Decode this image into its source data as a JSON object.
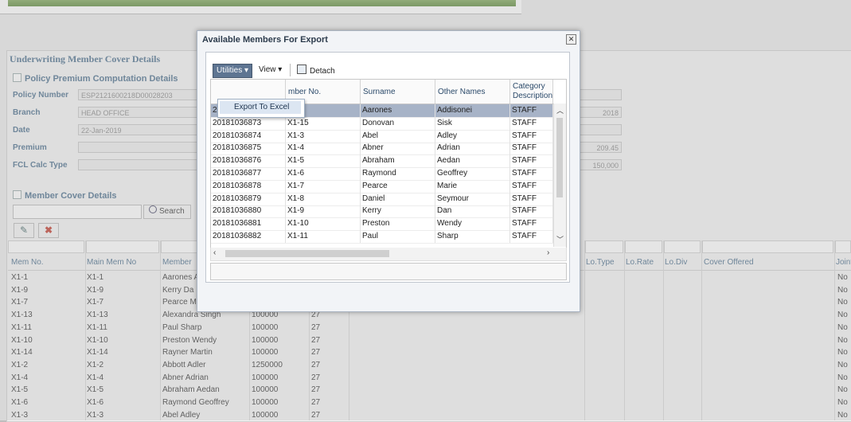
{
  "background": {
    "page_title": "Underwriting Member Cover Details",
    "premium_section": {
      "title": "Policy Premium Computation Details",
      "fields": [
        {
          "label": "Policy Number",
          "value": "ESP2121600218D00028203"
        },
        {
          "label": "Branch",
          "value": "HEAD OFFICE"
        },
        {
          "label": "Date",
          "value": "22-Jan-2019"
        },
        {
          "label": "Premium",
          "value": ""
        },
        {
          "label": "FCL Calc Type",
          "value": ""
        }
      ],
      "right_values": [
        "2018",
        "",
        "209.45",
        "150,000"
      ]
    },
    "member_section": {
      "title": "Member Cover Details",
      "search_label": "Search",
      "columns": [
        "Mem No.",
        "Main Mem No",
        "Member",
        "Lo.Type",
        "Lo.Rate",
        "Lo.Div",
        "Cover Offered",
        "Joint"
      ],
      "rows": [
        [
          "X1-1",
          "X1-1",
          "Aarones A",
          "",
          "",
          "No"
        ],
        [
          "X1-9",
          "X1-9",
          "Kerry Da",
          "",
          "",
          "No"
        ],
        [
          "X1-7",
          "X1-7",
          "Pearce M",
          "",
          "",
          "No"
        ],
        [
          "X1-13",
          "X1-13",
          "Alexandra Singh",
          "100000",
          "27",
          "No"
        ],
        [
          "X1-11",
          "X1-11",
          "Paul Sharp",
          "100000",
          "27",
          "No"
        ],
        [
          "X1-10",
          "X1-10",
          "Preston Wendy",
          "100000",
          "27",
          "No"
        ],
        [
          "X1-14",
          "X1-14",
          "Rayner Martin",
          "100000",
          "27",
          "No"
        ],
        [
          "X1-2",
          "X1-2",
          "Abbott Adler",
          "1250000",
          "27",
          "No"
        ],
        [
          "X1-4",
          "X1-4",
          "Abner Adrian",
          "100000",
          "27",
          "No"
        ],
        [
          "X1-5",
          "X1-5",
          "Abraham Aedan",
          "100000",
          "27",
          "No"
        ],
        [
          "X1-6",
          "X1-6",
          "Raymond Geoffrey",
          "100000",
          "27",
          "No"
        ],
        [
          "X1-3",
          "X1-3",
          "Abel Adley",
          "100000",
          "27",
          "No"
        ]
      ]
    }
  },
  "dialog": {
    "title": "Available Members For Export",
    "toolbar": {
      "utilities": "Utilities",
      "view": "View",
      "detach": "Detach"
    },
    "menu": {
      "export_excel": "Export To Excel"
    },
    "columns": [
      "",
      "Member No.",
      "Surname",
      "Other Names",
      "Category Description"
    ],
    "header_partial": "mber No.",
    "rows": [
      [
        "20181036872",
        "X1-1",
        "Aarones",
        "Addisonei",
        "STAFF"
      ],
      [
        "20181036873",
        "X1-15",
        "Donovan",
        "Sisk",
        "STAFF"
      ],
      [
        "20181036874",
        "X1-3",
        "Abel",
        "Adley",
        "STAFF"
      ],
      [
        "20181036875",
        "X1-4",
        "Abner",
        "Adrian",
        "STAFF"
      ],
      [
        "20181036876",
        "X1-5",
        "Abraham",
        "Aedan",
        "STAFF"
      ],
      [
        "20181036877",
        "X1-6",
        "Raymond",
        "Geoffrey",
        "STAFF"
      ],
      [
        "20181036878",
        "X1-7",
        "Pearce",
        "Marie",
        "STAFF"
      ],
      [
        "20181036879",
        "X1-8",
        "Daniel",
        "Seymour",
        "STAFF"
      ],
      [
        "20181036880",
        "X1-9",
        "Kerry",
        "Dan",
        "STAFF"
      ],
      [
        "20181036881",
        "X1-10",
        "Preston",
        "Wendy",
        "STAFF"
      ],
      [
        "20181036882",
        "X1-11",
        "Paul",
        "Sharp",
        "STAFF"
      ]
    ]
  }
}
